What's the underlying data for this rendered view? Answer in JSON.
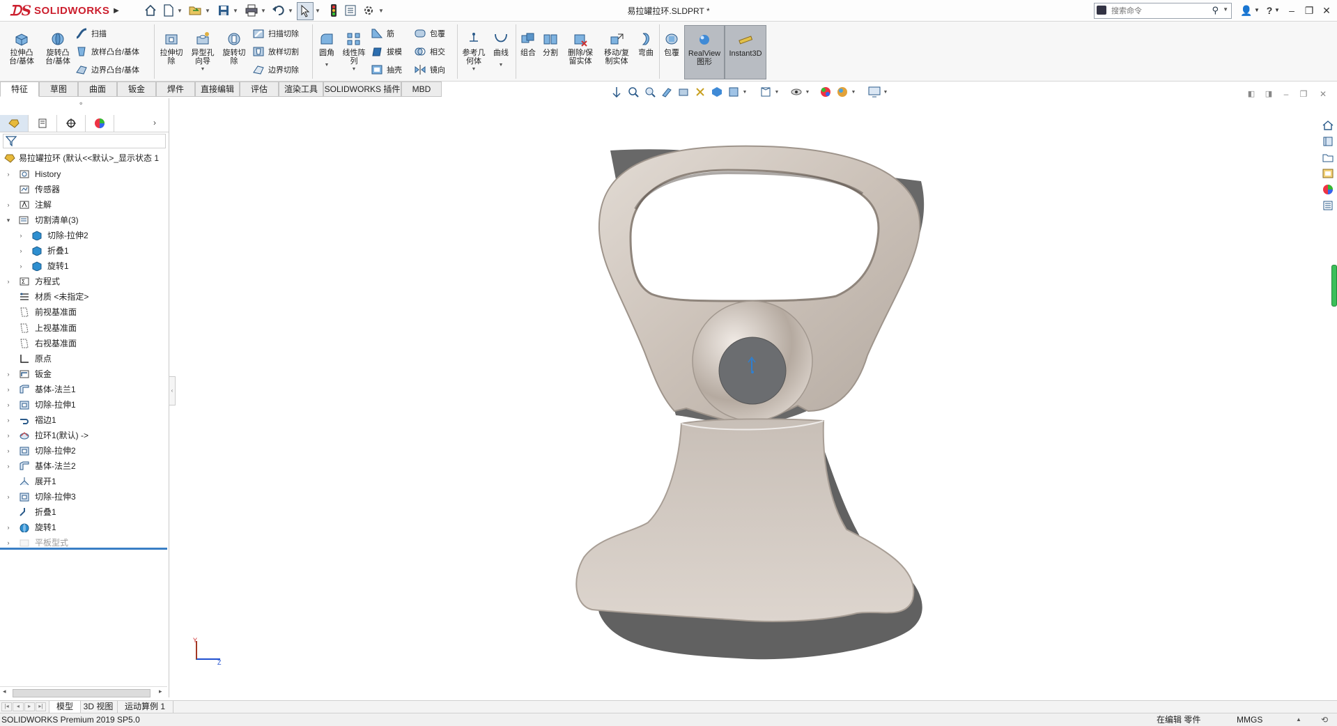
{
  "app": {
    "logo_text": "SOLIDWORKS",
    "document_title": "易拉罐拉环.SLDPRT *",
    "search_placeholder": "搜索命令"
  },
  "quick_access": [
    {
      "name": "home",
      "icon": "home-icon"
    },
    {
      "name": "new",
      "icon": "new-document-icon"
    },
    {
      "name": "open",
      "icon": "open-folder-icon"
    },
    {
      "name": "save",
      "icon": "save-icon"
    },
    {
      "name": "print",
      "icon": "print-icon"
    },
    {
      "name": "undo",
      "icon": "undo-icon"
    },
    {
      "name": "select",
      "icon": "select-cursor-icon"
    },
    {
      "name": "rebuild",
      "icon": "traffic-light-icon"
    },
    {
      "name": "file-properties",
      "icon": "file-properties-icon"
    },
    {
      "name": "options",
      "icon": "gear-icon"
    }
  ],
  "ribbon": {
    "extrude_boss": "拉伸凸\n台/基体",
    "revolve_boss": "旋转凸\n台/基体",
    "sweep": "扫描",
    "loft_boss": "放样凸台/基体",
    "boundary_boss": "边界凸台/基体",
    "extrude_cut": "拉伸切\n除",
    "hole_wizard": "异型孔\n向导",
    "revolve_cut": "旋转切\n除",
    "swept_cut": "扫描切除",
    "lofted_cut": "放样切割",
    "boundary_cut": "边界切除",
    "fillet": "圆角",
    "linear_pattern": "线性阵\n列",
    "rib": "筋",
    "draft": "拔模",
    "shell": "抽壳",
    "wrap": "包覆",
    "intersect": "相交",
    "mirror": "镜向",
    "reference_geometry": "参考几\n何体",
    "curves": "曲线",
    "combine": "组合",
    "split": "分割",
    "delete_keep_body": "删除/保\n留实体",
    "move_copy_body": "移动/复\n制实体",
    "flex": "弯曲",
    "wrap2": "包覆",
    "realview": "RealView\n图形",
    "instant3d": "Instant3D"
  },
  "tabs": [
    "特征",
    "草图",
    "曲面",
    "钣金",
    "焊件",
    "直接编辑",
    "评估",
    "渲染工具",
    "SOLIDWORKS 插件",
    "MBD"
  ],
  "active_tab": "特征",
  "feature_tree": {
    "root": "易拉罐拉环  (默认<<默认>_显示状态 1",
    "items": [
      {
        "label": "History",
        "level": 1,
        "arrow": "collapsed",
        "icon": "history-icon"
      },
      {
        "label": "传感器",
        "level": 1,
        "arrow": "none",
        "icon": "sensor-icon"
      },
      {
        "label": "注解",
        "level": 1,
        "arrow": "collapsed",
        "icon": "annotation-icon"
      },
      {
        "label": "切割清单(3)",
        "level": 1,
        "arrow": "expanded",
        "icon": "cut-list-icon"
      },
      {
        "label": "切除-拉伸2",
        "level": 2,
        "arrow": "collapsed",
        "icon": "solid-body-icon"
      },
      {
        "label": "折叠1",
        "level": 2,
        "arrow": "collapsed",
        "icon": "solid-body-icon"
      },
      {
        "label": "旋转1",
        "level": 2,
        "arrow": "collapsed",
        "icon": "solid-body-icon"
      },
      {
        "label": "方程式",
        "level": 1,
        "arrow": "collapsed",
        "icon": "equation-icon"
      },
      {
        "label": "材质 <未指定>",
        "level": 1,
        "arrow": "none",
        "icon": "material-icon"
      },
      {
        "label": "前视基准面",
        "level": 1,
        "arrow": "none",
        "icon": "plane-icon"
      },
      {
        "label": "上视基准面",
        "level": 1,
        "arrow": "none",
        "icon": "plane-icon"
      },
      {
        "label": "右视基准面",
        "level": 1,
        "arrow": "none",
        "icon": "plane-icon"
      },
      {
        "label": "原点",
        "level": 1,
        "arrow": "none",
        "icon": "origin-icon"
      },
      {
        "label": "钣金",
        "level": 1,
        "arrow": "collapsed",
        "icon": "sheet-metal-icon"
      },
      {
        "label": "基体-法兰1",
        "level": 1,
        "arrow": "collapsed",
        "icon": "base-flange-icon"
      },
      {
        "label": "切除-拉伸1",
        "level": 1,
        "arrow": "collapsed",
        "icon": "extrude-cut-icon"
      },
      {
        "label": "褶边1",
        "level": 1,
        "arrow": "collapsed",
        "icon": "hem-icon"
      },
      {
        "label": "拉环1(默认) ->",
        "level": 1,
        "arrow": "collapsed",
        "icon": "forming-tool-icon"
      },
      {
        "label": "切除-拉伸2",
        "level": 1,
        "arrow": "collapsed",
        "icon": "extrude-cut-icon"
      },
      {
        "label": "基体-法兰2",
        "level": 1,
        "arrow": "collapsed",
        "icon": "base-flange-icon"
      },
      {
        "label": "展开1",
        "level": 1,
        "arrow": "none",
        "icon": "unfold-icon"
      },
      {
        "label": "切除-拉伸3",
        "level": 1,
        "arrow": "collapsed",
        "icon": "extrude-cut-icon"
      },
      {
        "label": "折叠1",
        "level": 1,
        "arrow": "none",
        "icon": "fold-icon"
      },
      {
        "label": "旋转1",
        "level": 1,
        "arrow": "collapsed",
        "icon": "revolve-icon"
      },
      {
        "label": "平板型式",
        "level": 1,
        "arrow": "collapsed",
        "icon": "flat-pattern-icon",
        "suppressed": true
      }
    ]
  },
  "bottom_tabs": [
    "模型",
    "3D 视图",
    "运动算例 1"
  ],
  "active_bottom_tab": "模型",
  "status": {
    "product": "SOLIDWORKS Premium 2019 SP5.0",
    "editing": "在编辑 零件",
    "units": "MMGS"
  },
  "triad": {
    "y": "Y",
    "z": "Z"
  },
  "colors": {
    "accent_red": "#cc1f2e",
    "part_metal": "#c9bfb6",
    "hub_gray": "#6b6d70",
    "selection_blue": "#2f7fd0"
  }
}
